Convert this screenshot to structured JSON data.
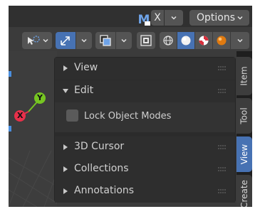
{
  "header": {
    "collection_tag": "X",
    "options_label": "Options"
  },
  "panel": {
    "sections": [
      {
        "label": "View",
        "expanded": false
      },
      {
        "label": "Edit",
        "expanded": true
      },
      {
        "label": "3D Cursor",
        "expanded": false
      },
      {
        "label": "Collections",
        "expanded": false
      },
      {
        "label": "Annotations",
        "expanded": false
      }
    ],
    "lock_object_modes": {
      "label": "Lock Object Modes",
      "checked": false
    }
  },
  "tabs": [
    {
      "label": "Item",
      "active": false
    },
    {
      "label": "Tool",
      "active": false
    },
    {
      "label": "View",
      "active": true
    },
    {
      "label": "Create",
      "active": false
    }
  ],
  "gizmo": {
    "y_label": "Y",
    "x_label": "X"
  },
  "colors": {
    "accent": "#4772b3",
    "y_axis": "#76c522",
    "x_axis": "#e8304a",
    "panel_bg": "#2b2b2b",
    "viewport_bg": "#3d3d3d"
  },
  "icons": {
    "toolbar": [
      "select-box-icon",
      "transform-arrows-icon",
      "overlay-squares-icon",
      "xray-toggle-icon",
      "wireframe-shading-icon",
      "solid-shading-icon",
      "material-shading-icon",
      "rendered-shading-icon"
    ]
  }
}
